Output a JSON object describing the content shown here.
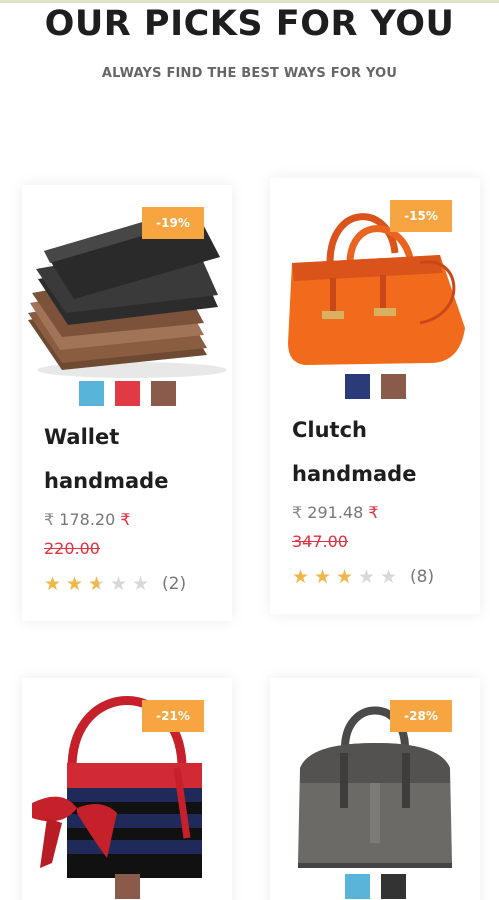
{
  "header": {
    "title": "OUR PICKS FOR YOU",
    "subtitle": "ALWAYS FIND THE BEST WAYS FOR YOU"
  },
  "products": [
    {
      "name_line1": "Wallet",
      "name_line2": "handmade",
      "discount": "-19%",
      "currency": "₹",
      "price": "178.20",
      "old_price": "220.00",
      "rating": 2.5,
      "review_count": "(2)",
      "swatches": [
        "#58b4d8",
        "#e03a44",
        "#8a5a4a"
      ],
      "image_icon": "wallet-stack-icon"
    },
    {
      "name_line1": "Clutch",
      "name_line2": "handmade",
      "discount": "-15%",
      "currency": "₹",
      "price": "291.48",
      "old_price": "347.00",
      "rating": 3,
      "review_count": "(8)",
      "swatches": [
        "#2a3b7a",
        "#8a5a4a"
      ],
      "image_icon": "orange-handbag-icon"
    },
    {
      "discount": "-21%",
      "swatches": [
        "#8a5a4a"
      ],
      "image_icon": "red-striped-bag-icon"
    },
    {
      "discount": "-28%",
      "swatches": [
        "#58b4d8",
        "#333333"
      ],
      "image_icon": "grey-croc-bag-icon"
    }
  ],
  "colors": {
    "badge": "#f6a540",
    "star": "#f0b64a",
    "old_price": "#e3303f"
  }
}
